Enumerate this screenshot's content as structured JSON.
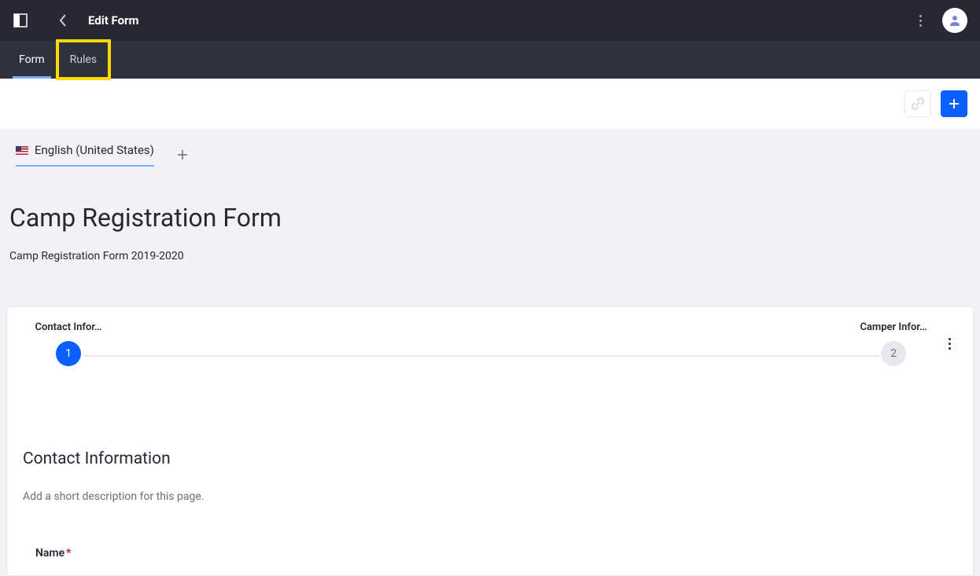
{
  "header": {
    "title": "Edit Form"
  },
  "tabs": {
    "form": "Form",
    "rules": "Rules",
    "active": "form",
    "highlighted": "rules"
  },
  "language": {
    "current": "English (United States)"
  },
  "form": {
    "title": "Camp Registration Form",
    "subtitle": "Camp Registration Form 2019-2020"
  },
  "stepper": {
    "steps": [
      {
        "number": "1",
        "label": "Contact Infor…",
        "active": true
      },
      {
        "number": "2",
        "label": "Camper Infor…",
        "active": false
      }
    ]
  },
  "section": {
    "title": "Contact Information",
    "description": "Add a short description for this page."
  },
  "fields": {
    "name": {
      "label": "Name",
      "required": "*"
    }
  }
}
